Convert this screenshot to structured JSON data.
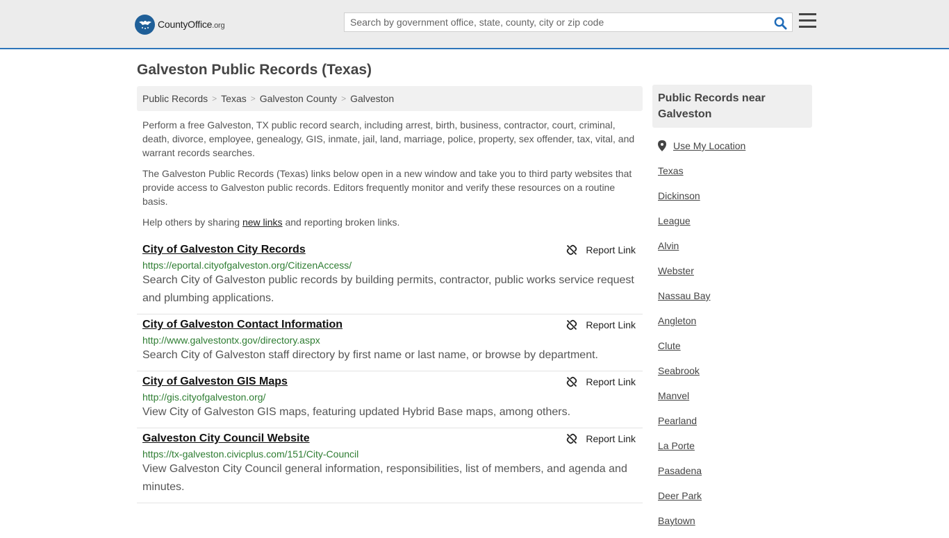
{
  "header": {
    "logo_main": "CountyOffice",
    "logo_org": ".org",
    "search_placeholder": "Search by government office, state, county, city or zip code"
  },
  "page_title": "Galveston Public Records (Texas)",
  "breadcrumb": [
    "Public Records",
    "Texas",
    "Galveston County",
    "Galveston"
  ],
  "intro": {
    "p1": "Perform a free Galveston, TX public record search, including arrest, birth, business, contractor, court, criminal, death, divorce, employee, genealogy, GIS, inmate, jail, land, marriage, police, property, sex offender, tax, vital, and warrant records searches.",
    "p2": "The Galveston Public Records (Texas) links below open in a new window and take you to third party websites that provide access to Galveston public records. Editors frequently monitor and verify these resources on a routine basis.",
    "p3_before": "Help others by sharing ",
    "p3_link": "new links",
    "p3_after": " and reporting broken links."
  },
  "report_label": "Report Link",
  "records": [
    {
      "title": "City of Galveston City Records",
      "url": "https://eportal.cityofgalveston.org/CitizenAccess/",
      "desc": "Search City of Galveston public records by building permits, contractor, public works service request and plumbing applications."
    },
    {
      "title": "City of Galveston Contact Information",
      "url": "http://www.galvestontx.gov/directory.aspx",
      "desc": "Search City of Galveston staff directory by first name or last name, or browse by department."
    },
    {
      "title": "City of Galveston GIS Maps",
      "url": "http://gis.cityofgalveston.org/",
      "desc": "View City of Galveston GIS maps, featuring updated Hybrid Base maps, among others."
    },
    {
      "title": "Galveston City Council Website",
      "url": "https://tx-galveston.civicplus.com/151/City-Council",
      "desc": "View Galveston City Council general information, responsibilities, list of members, and agenda and minutes."
    }
  ],
  "sidebar": {
    "heading": "Public Records near Galveston",
    "use_location": "Use My Location",
    "links": [
      "Texas",
      "Dickinson",
      "League",
      "Alvin",
      "Webster",
      "Nassau Bay",
      "Angleton",
      "Clute",
      "Seabrook",
      "Manvel",
      "Pearland",
      "La Porte",
      "Pasadena",
      "Deer Park",
      "Baytown"
    ]
  },
  "colors": {
    "accent": "#2d75ba",
    "url_green": "#2e7d32",
    "search_icon": "#1e6bb8"
  },
  "icons": {
    "logo": "eagle-seal-icon",
    "search": "search-icon",
    "menu": "hamburger-menu-icon",
    "report": "broken-link-icon",
    "location": "map-pin-icon"
  }
}
